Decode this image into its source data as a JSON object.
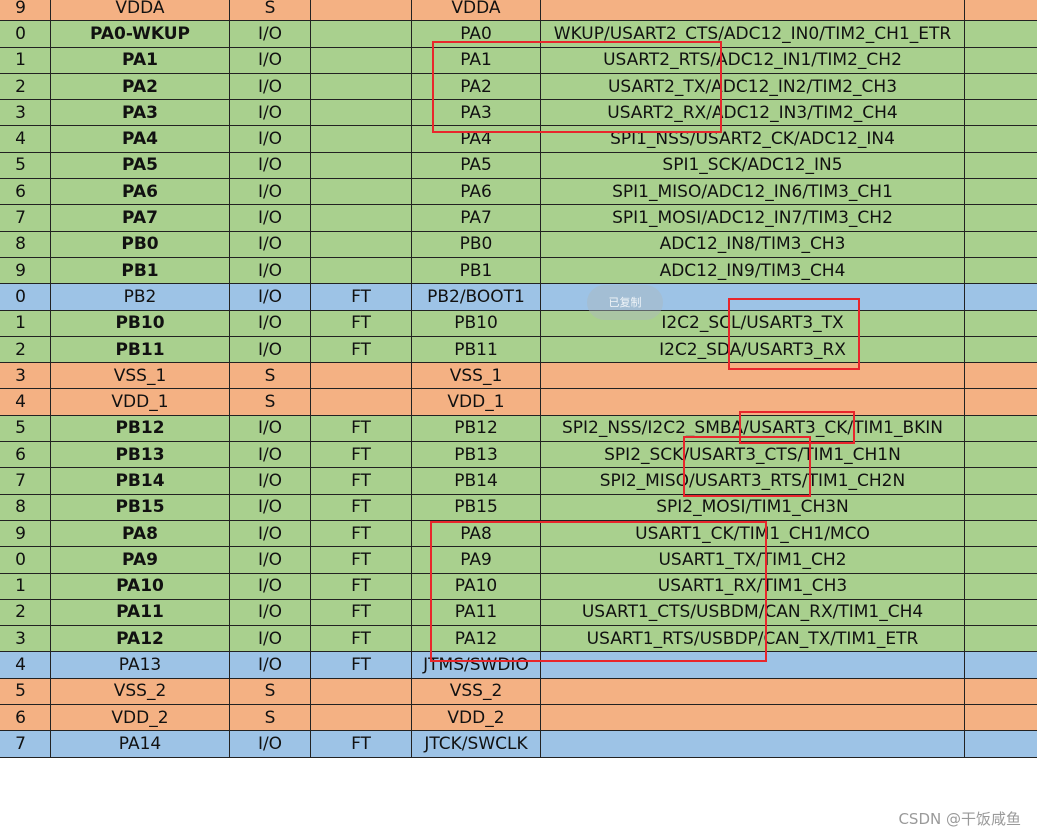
{
  "table": {
    "rows": [
      {
        "num": "9",
        "name": "VDDA",
        "bold": false,
        "type": "S",
        "ft": "",
        "main": "VDDA",
        "alt": "",
        "color": "orange"
      },
      {
        "num": "0",
        "name": "PA0-WKUP",
        "bold": true,
        "type": "I/O",
        "ft": "",
        "main": "PA0",
        "alt": "WKUP/USART2_CTS/ADC12_IN0/TIM2_CH1_ETR",
        "color": "green"
      },
      {
        "num": "1",
        "name": "PA1",
        "bold": true,
        "type": "I/O",
        "ft": "",
        "main": "PA1",
        "alt": "USART2_RTS/ADC12_IN1/TIM2_CH2",
        "color": "green"
      },
      {
        "num": "2",
        "name": "PA2",
        "bold": true,
        "type": "I/O",
        "ft": "",
        "main": "PA2",
        "alt": "USART2_TX/ADC12_IN2/TIM2_CH3",
        "color": "green"
      },
      {
        "num": "3",
        "name": "PA3",
        "bold": true,
        "type": "I/O",
        "ft": "",
        "main": "PA3",
        "alt": "USART2_RX/ADC12_IN3/TIM2_CH4",
        "color": "green"
      },
      {
        "num": "4",
        "name": "PA4",
        "bold": true,
        "type": "I/O",
        "ft": "",
        "main": "PA4",
        "alt": "SPI1_NSS/USART2_CK/ADC12_IN4",
        "color": "green"
      },
      {
        "num": "5",
        "name": "PA5",
        "bold": true,
        "type": "I/O",
        "ft": "",
        "main": "PA5",
        "alt": "SPI1_SCK/ADC12_IN5",
        "color": "green"
      },
      {
        "num": "6",
        "name": "PA6",
        "bold": true,
        "type": "I/O",
        "ft": "",
        "main": "PA6",
        "alt": "SPI1_MISO/ADC12_IN6/TIM3_CH1",
        "color": "green"
      },
      {
        "num": "7",
        "name": "PA7",
        "bold": true,
        "type": "I/O",
        "ft": "",
        "main": "PA7",
        "alt": "SPI1_MOSI/ADC12_IN7/TIM3_CH2",
        "color": "green"
      },
      {
        "num": "8",
        "name": "PB0",
        "bold": true,
        "type": "I/O",
        "ft": "",
        "main": "PB0",
        "alt": "ADC12_IN8/TIM3_CH3",
        "color": "green"
      },
      {
        "num": "9",
        "name": "PB1",
        "bold": true,
        "type": "I/O",
        "ft": "",
        "main": "PB1",
        "alt": "ADC12_IN9/TIM3_CH4",
        "color": "green"
      },
      {
        "num": "0",
        "name": "PB2",
        "bold": false,
        "type": "I/O",
        "ft": "FT",
        "main": "PB2/BOOT1",
        "alt": "",
        "color": "blue"
      },
      {
        "num": "1",
        "name": "PB10",
        "bold": true,
        "type": "I/O",
        "ft": "FT",
        "main": "PB10",
        "alt": "I2C2_SCL/USART3_TX",
        "color": "green"
      },
      {
        "num": "2",
        "name": "PB11",
        "bold": true,
        "type": "I/O",
        "ft": "FT",
        "main": "PB11",
        "alt": "I2C2_SDA/USART3_RX",
        "color": "green"
      },
      {
        "num": "3",
        "name": "VSS_1",
        "bold": false,
        "type": "S",
        "ft": "",
        "main": "VSS_1",
        "alt": "",
        "color": "orange"
      },
      {
        "num": "4",
        "name": "VDD_1",
        "bold": false,
        "type": "S",
        "ft": "",
        "main": "VDD_1",
        "alt": "",
        "color": "orange"
      },
      {
        "num": "5",
        "name": "PB12",
        "bold": true,
        "type": "I/O",
        "ft": "FT",
        "main": "PB12",
        "alt": "SPI2_NSS/I2C2_SMBA/USART3_CK/TIM1_BKIN",
        "color": "green"
      },
      {
        "num": "6",
        "name": "PB13",
        "bold": true,
        "type": "I/O",
        "ft": "FT",
        "main": "PB13",
        "alt": "SPI2_SCK/USART3_CTS/TIM1_CH1N",
        "color": "green"
      },
      {
        "num": "7",
        "name": "PB14",
        "bold": true,
        "type": "I/O",
        "ft": "FT",
        "main": "PB14",
        "alt": "SPI2_MISO/USART3_RTS/TIM1_CH2N",
        "color": "green"
      },
      {
        "num": "8",
        "name": "PB15",
        "bold": true,
        "type": "I/O",
        "ft": "FT",
        "main": "PB15",
        "alt": "SPI2_MOSI/TIM1_CH3N",
        "color": "green"
      },
      {
        "num": "9",
        "name": "PA8",
        "bold": true,
        "type": "I/O",
        "ft": "FT",
        "main": "PA8",
        "alt": "USART1_CK/TIM1_CH1/MCO",
        "color": "green"
      },
      {
        "num": "0",
        "name": "PA9",
        "bold": true,
        "type": "I/O",
        "ft": "FT",
        "main": "PA9",
        "alt": "USART1_TX/TIM1_CH2",
        "color": "green"
      },
      {
        "num": "1",
        "name": "PA10",
        "bold": true,
        "type": "I/O",
        "ft": "FT",
        "main": "PA10",
        "alt": "USART1_RX/TIM1_CH3",
        "color": "green"
      },
      {
        "num": "2",
        "name": "PA11",
        "bold": true,
        "type": "I/O",
        "ft": "FT",
        "main": "PA11",
        "alt": "USART1_CTS/USBDM/CAN_RX/TIM1_CH4",
        "color": "green"
      },
      {
        "num": "3",
        "name": "PA12",
        "bold": true,
        "type": "I/O",
        "ft": "FT",
        "main": "PA12",
        "alt": "USART1_RTS/USBDP/CAN_TX/TIM1_ETR",
        "color": "green"
      },
      {
        "num": "4",
        "name": "PA13",
        "bold": false,
        "type": "I/O",
        "ft": "FT",
        "main": "JTMS/SWDIO",
        "alt": "",
        "color": "blue"
      },
      {
        "num": "5",
        "name": "VSS_2",
        "bold": false,
        "type": "S",
        "ft": "",
        "main": "VSS_2",
        "alt": "",
        "color": "orange"
      },
      {
        "num": "6",
        "name": "VDD_2",
        "bold": false,
        "type": "S",
        "ft": "",
        "main": "VDD_2",
        "alt": "",
        "color": "orange"
      },
      {
        "num": "7",
        "name": "PA14",
        "bold": false,
        "type": "I/O",
        "ft": "FT",
        "main": "JTCK/SWCLK",
        "alt": "",
        "color": "blue"
      }
    ]
  },
  "overlay": {
    "copy_toast": "已复制"
  },
  "colors": {
    "green": "#a9d08e",
    "blue": "#9dc3e6",
    "orange": "#f4b183",
    "highlight": "#e8262c"
  },
  "watermark": "CSDN @干饭咸鱼"
}
